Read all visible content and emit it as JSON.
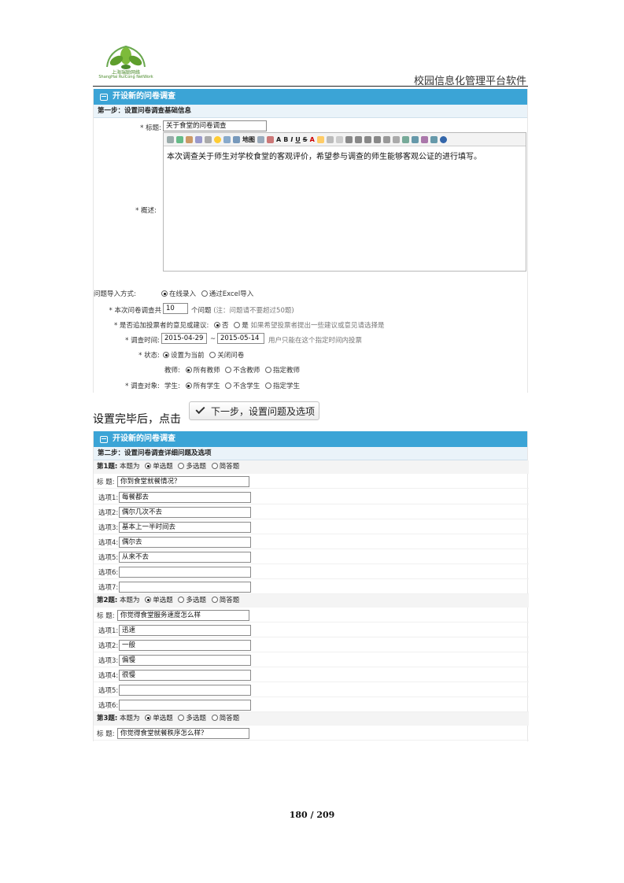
{
  "header": {
    "logo_text_cn": "上海瑞聪网络",
    "logo_text_en": "ShangHai RuiCong NetWork",
    "title": "校园信息化管理平台软件"
  },
  "panel1": {
    "title": "开设新的问卷调查",
    "step": "第一步：设置问卷调查基础信息",
    "title_label": "* 标题:",
    "title_value": "关于食堂的问卷调查",
    "desc_label": "* 概述:",
    "toolbar_map_label": "地图",
    "desc_value": "本次调查关于师生对学校食堂的客观评价，希望参与调查的师生能够客观公证的进行填写。",
    "import_label": "问题导入方式:",
    "import_options": [
      "在线录入",
      "通过Excel导入"
    ],
    "count_label": "* 本次问卷调查共",
    "count_value": "10",
    "count_unit": "个问题",
    "count_note": "(注：问题请不要超过50题)",
    "suggest_label": "* 是否追加投票者的意见或建议:",
    "suggest_no": "否",
    "suggest_yes": "是",
    "suggest_note": "如果希望投票者提出一些建议或意见请选择是",
    "time_label": "* 调查时间:",
    "time_start": "2015-04-29",
    "time_sep": "~",
    "time_end": "2015-05-14",
    "time_note": "用户只能在这个指定时间内投票",
    "status_label": "* 状态:",
    "status_options": [
      "设置为当前",
      "关闭问卷"
    ],
    "target_label": "* 调查对象:",
    "teacher_label": "教师:",
    "teacher_options": [
      "所有教师",
      "不含教师",
      "指定教师"
    ],
    "student_label": "学生:",
    "student_options": [
      "所有学生",
      "不含学生",
      "指定学生"
    ]
  },
  "middle": {
    "text": "设置完毕后，点击",
    "button": "下一步，设置问题及选项"
  },
  "panel2": {
    "title": "开设新的问卷调查",
    "step": "第二步：设置问卷调查详细问题及选项",
    "type_prefix": "本题为",
    "type_options": [
      "单选题",
      "多选题",
      "简答题"
    ],
    "title_label": "标  题:",
    "q1": {
      "num": "第1题:",
      "title": "你到食堂就餐情况？",
      "options": [
        {
          "label": "选项1:",
          "value": "每餐都去"
        },
        {
          "label": "选项2:",
          "value": "偶尔几次不去"
        },
        {
          "label": "选项3:",
          "value": "基本上一半时间去"
        },
        {
          "label": "选项4:",
          "value": "偶尔去"
        },
        {
          "label": "选项5:",
          "value": "从来不去"
        },
        {
          "label": "选项6:",
          "value": ""
        },
        {
          "label": "选项7:",
          "value": ""
        }
      ]
    },
    "q2": {
      "num": "第2题:",
      "title": "你觉得食堂服务速度怎么样",
      "options": [
        {
          "label": "选项1:",
          "value": "迅速"
        },
        {
          "label": "选项2:",
          "value": "一般"
        },
        {
          "label": "选项3:",
          "value": "偏慢"
        },
        {
          "label": "选项4:",
          "value": "很慢"
        },
        {
          "label": "选项5:",
          "value": ""
        },
        {
          "label": "选项6:",
          "value": ""
        }
      ]
    },
    "q3": {
      "num": "第3题:",
      "title": "你觉得食堂就餐秩序怎么样？"
    }
  },
  "footer": {
    "page": "180 / 209"
  },
  "colors": {
    "panel_header": "#3ba4d6",
    "step_bar": "#eaf3f9",
    "logo_green": "#4a8a2a"
  }
}
